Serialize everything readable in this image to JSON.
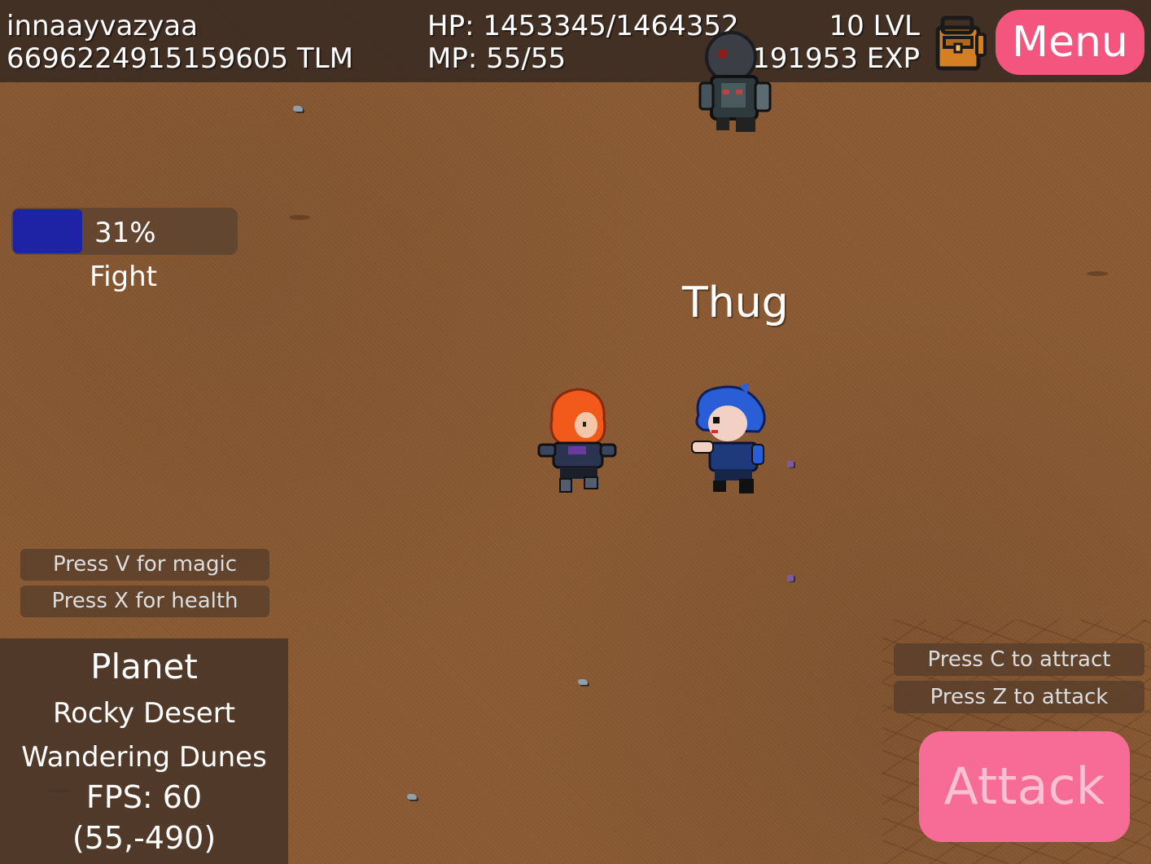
{
  "hud": {
    "player_name": "innaayvazyaa",
    "tlm": "6696224915159605 TLM",
    "hp": "HP: 1453345/1464352",
    "mp": "MP: 55/55",
    "level": "10 LVL",
    "exp": "191953 EXP",
    "menu_label": "Menu"
  },
  "fight": {
    "progress_fraction": 0.31,
    "percent_label": "31%",
    "label": "Fight"
  },
  "enemy": {
    "name": "Thug"
  },
  "hints": {
    "magic": "Press V for magic",
    "health": "Press X for health",
    "attract": "Press C to attract",
    "attack": "Press Z to attack"
  },
  "location": {
    "title": "Planet",
    "region": "Rocky Desert",
    "area": "Wandering Dunes",
    "fps": "FPS: 60",
    "coords": "(55,-490)"
  },
  "attack_label": "Attack",
  "icons": {
    "inventory": "backpack-icon"
  },
  "colors": {
    "accent": "#f3557f",
    "attack_button": "#f76b97",
    "fight_bar": "#1e22a5",
    "ground": "#8a5a33"
  }
}
